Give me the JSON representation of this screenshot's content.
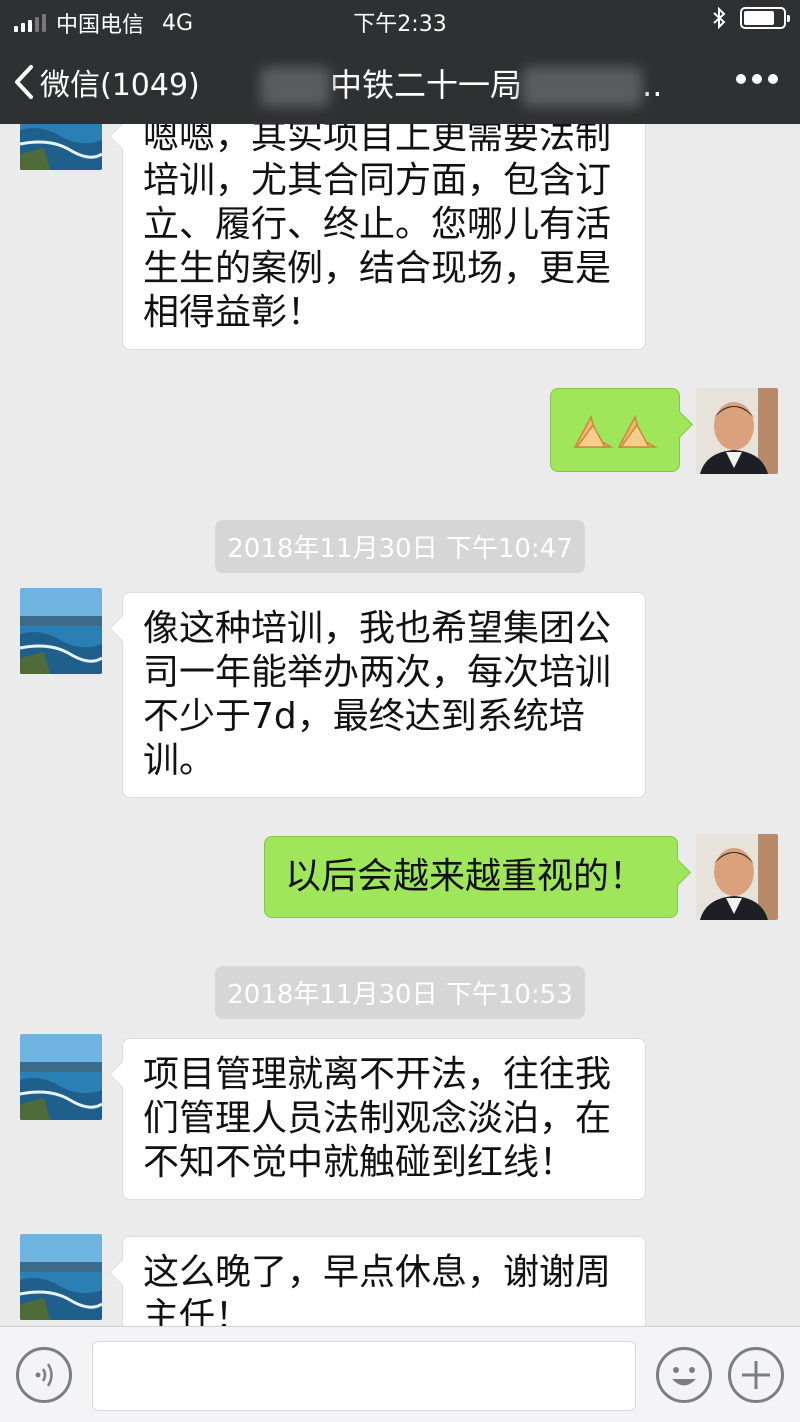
{
  "status_bar": {
    "carrier": "中国电信",
    "network": "4G",
    "time": "下午2:33",
    "bluetooth_icon": "bluetooth-icon",
    "battery_icon": "battery-icon",
    "battery_level": 0.8
  },
  "nav": {
    "back_label": "微信(1049)",
    "title": "中铁二十一局",
    "title_suffix": "..",
    "more_icon": "more-dots-icon"
  },
  "messages": [
    {
      "side": "left",
      "text": "嗯嗯，其实项目上更需要法制培训，尤其合同方面，包含订立、履行、终止。您哪儿有活生生的案例，结合现场，更是相得益彰！"
    },
    {
      "side": "right",
      "emoji": "clasped-hands-emoji"
    },
    {
      "timestamp": "2018年11月30日 下午10:47"
    },
    {
      "side": "left",
      "text": "像这种培训，我也希望集团公司一年能举办两次，每次培训不少于7d，最终达到系统培训。"
    },
    {
      "side": "right",
      "text": "以后会越来越重视的！"
    },
    {
      "timestamp": "2018年11月30日 下午10:53"
    },
    {
      "side": "left",
      "text": "项目管理就离不开法，往往我们管理人员法制观念淡泊，在不知不觉中就触碰到红线！"
    },
    {
      "side": "left",
      "text": "这么晚了，早点休息，谢谢周主任！"
    }
  ],
  "input_bar": {
    "voice_icon": "voice-icon",
    "text_value": "",
    "emoji_icon": "emoji-face-icon",
    "plus_icon": "plus-icon"
  },
  "colors": {
    "nav_bg": "#2e3132",
    "chat_bg": "#ebebeb",
    "my_bubble": "#9fe65b",
    "other_bubble": "#ffffff",
    "timestamp_bg": "#d6d6d6"
  }
}
